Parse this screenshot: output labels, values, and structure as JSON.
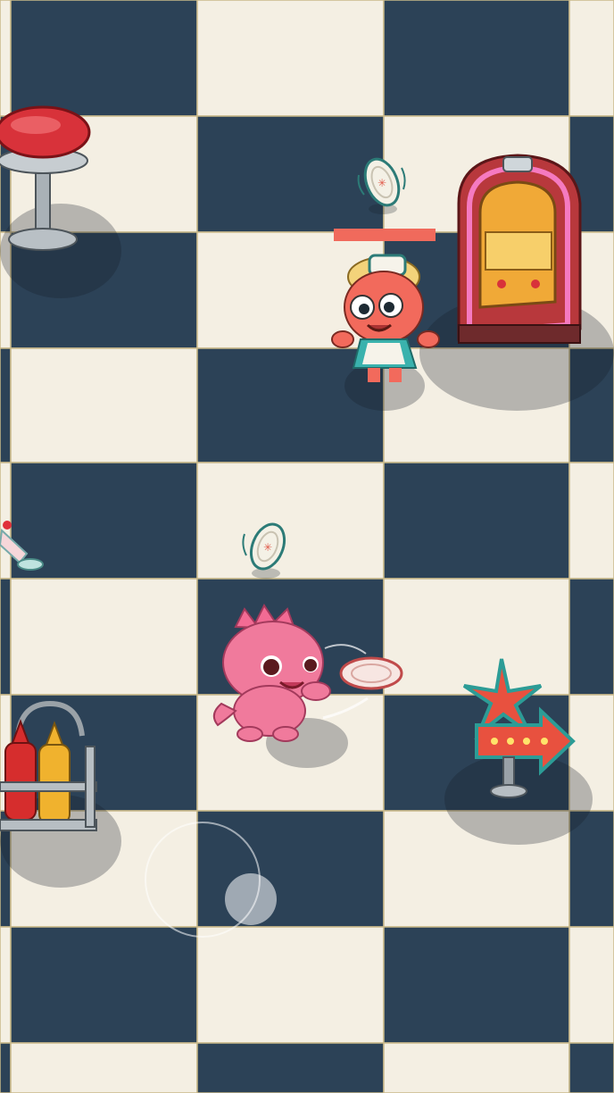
{
  "colors": {
    "tile_dark": "#2c4257",
    "tile_light": "#f4efe3",
    "grout": "#c9b98a",
    "accent_pink": "#f06a7c",
    "health_bar": "#f06a5c"
  },
  "hud": {
    "enemy_health_fraction": 1.0,
    "joystick_icon": "virtual-joystick"
  },
  "sprites": {
    "player": "pink-dinosaur-player",
    "enemy": "waitress-monster",
    "jukebox": "jukebox",
    "stool": "diner-stool",
    "condiments": "ketchup-mustard-caddy",
    "neon_sign": "neon-arrow-sign",
    "milkshake": "spilled-milkshake",
    "plate_projectile": "plate"
  }
}
